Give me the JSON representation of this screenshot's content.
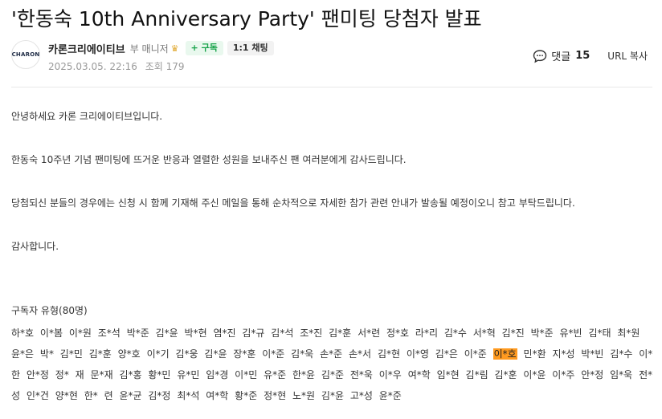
{
  "post": {
    "title": "'한동숙 10th Anniversary Party' 팬미팅 당첨자 발표",
    "author": {
      "avatar_text": "CHARON",
      "name": "카론크리에이티브",
      "role": "부 매니저",
      "role_icon": "crown-icon",
      "subscribe_label": "+ 구독",
      "chat_label": "1:1 채팅"
    },
    "date": "2025.03.05. 22:16",
    "views_label": "조회 179",
    "comments_label": "댓글",
    "comments_count": "15",
    "url_copy_label": "URL 복사",
    "colors": {
      "accent_green": "#17a34a",
      "highlight": "#ff9a1f"
    }
  },
  "content": {
    "p1": "안녕하세요 카론 크리에이티브입니다.",
    "p2": "한동숙 10주년 기념 팬미팅에 뜨거운 반응과 열렬한 성원을 보내주신 팬 여러분에게 감사드립니다.",
    "p3": "당첨되신 분들의 경우에는 신청 시 함께 기재해 주신 메일을 통해 순차적으로 자세한 참가 관련 안내가 발송될 예정이오니 참고 부탁드립니다.",
    "p4": "감사합니다.",
    "section_heading": "구독자 유형(80명)",
    "winners": [
      "하*호",
      "이*봄",
      "이*원",
      "조*석",
      "박*준",
      "김*윤",
      "박*현",
      "염*진",
      "김*규",
      "김*석",
      "조*진",
      "김*훈",
      "서*련",
      "정*호",
      "라*리",
      "김*수",
      "서*혁",
      "김*진",
      "박*준",
      "유*빈",
      "김*태",
      "최*원",
      "윤*은",
      "박*",
      "김*민",
      "김*훈",
      "양*호",
      "이*기",
      "김*웅",
      "김*윤",
      "장*훈",
      "이*준",
      "김*욱",
      "손*준",
      "손*서",
      "김*현",
      "이*영",
      "김*은",
      "이*준",
      "이*호",
      "민*환",
      "지*성",
      "박*빈",
      "김*수",
      "이*한",
      "안*정",
      "정*",
      "재",
      "문*재",
      "김*홍",
      "황*민",
      "유*민",
      "임*경",
      "이*민",
      "유*준",
      "한*윤",
      "김*준",
      "전*욱",
      "이*우",
      "여*학",
      "임*현",
      "김*림",
      "김*훈",
      "이*윤",
      "이*주",
      "안*정",
      "임*욱",
      "전*성",
      "인*건",
      "양*현",
      "한*",
      "련",
      "윤*균",
      "김*정",
      "최*석",
      "여*학",
      "황*준",
      "정*현",
      "노*원",
      "김*윤",
      "고*성",
      "윤*준"
    ],
    "highlight_index": 39
  }
}
